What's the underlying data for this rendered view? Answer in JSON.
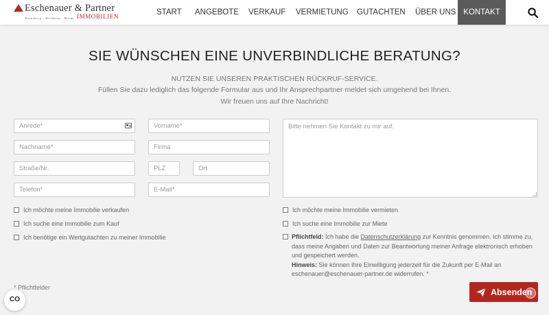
{
  "brand": {
    "name": "Eschenauer & Partner",
    "tagline": "Immobilien",
    "locations": "Weinsberg · Weilheim · Mainz"
  },
  "nav": {
    "items": [
      "START",
      "ANGEBOTE",
      "VERKAUF",
      "VERMIETUNG",
      "GUTACHTEN",
      "ÜBER UNS",
      "KONTAKT"
    ],
    "active": "KONTAKT"
  },
  "hero": {
    "title": "SIE WÜNSCHEN EINE UNVERBINDLICHE BERATUNG?",
    "line1": "NUTZEN SIE UNSEREN PRAKTISCHEN RÜCKRUF-SERVICE.",
    "line2": "Füllen Sie dazu lediglich das folgende Formular aus und Ihr Ansprechpartner meldet sich umgehend bei Ihnen.",
    "line3": "Wir freuen uns auf Ihre Nachricht!"
  },
  "form": {
    "anrede": "Anrede*",
    "vorname": "Vorname*",
    "nachname": "Nachname*",
    "firma": "Firma",
    "strasse": "Straße/Nr.",
    "plz": "PLZ",
    "ort": "Ort",
    "telefon": "Telefon*",
    "email": "E-Mail*",
    "message": "Bitte nehmen Sie Kontakt zu mir auf."
  },
  "checkboxes": {
    "verkaufen": "Ich möchte meine Immobilie verkaufen",
    "kauf": "Ich suche eine Immobilie zum Kauf",
    "wertgutachten": "Ich benötige ein Wertgutachten zu meiner Immobilie",
    "vermieten": "Ich möchte meine Immobilie vermieten",
    "miete": "Ich suche eine Immobilie zur Miete"
  },
  "consent": {
    "label": "Pflichtfeld:",
    "text_before": " Ich habe die ",
    "link": "Datenschutzerklärung",
    "text_after": " zur Kenntnis genommen. Ich stimme zu, dass meine Angaben und Daten zur Beantwortung meiner Anfrage elektronisch erhoben und gespeichert werden.",
    "hint_label": "Hinweis:",
    "hint_text": " Sie können Ihre Einwilligung jederzeit für die Zukunft per E-Mail an eschenauer@eschenauer-partner.de widerrufen. *"
  },
  "footer": {
    "required_note": "* Pflichtfelder",
    "submit": "Absenden",
    "cookie_label": "CO"
  },
  "colors": {
    "accent": "#b3261e",
    "nav_active_bg": "#5a5a5a",
    "page_bg": "#f2f2f2"
  }
}
